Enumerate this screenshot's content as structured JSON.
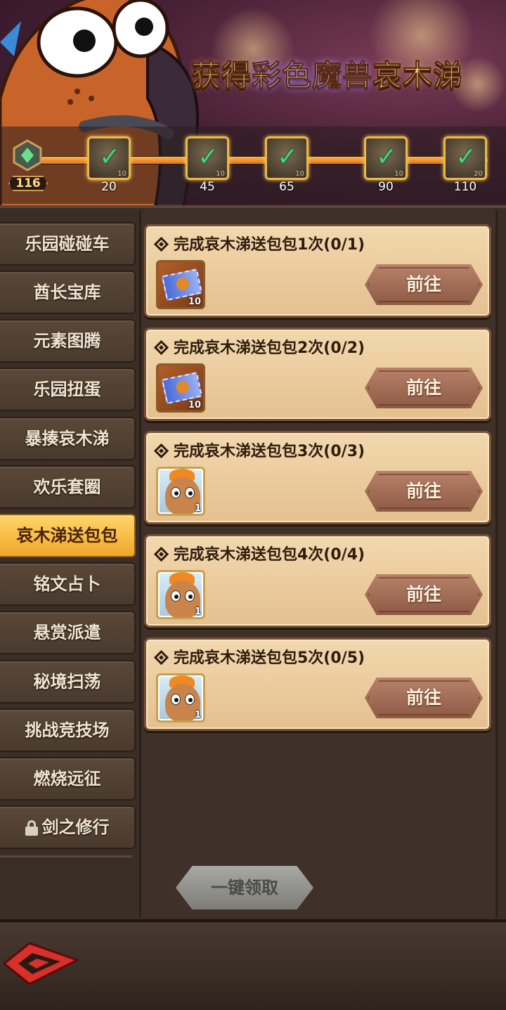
{
  "banner": {
    "title_part1": "获得",
    "title_part2": "彩色魔兽",
    "title_part3": "哀木涕"
  },
  "progress": {
    "current_level": "116",
    "fill_fraction": 1.0,
    "milestones": [
      {
        "label": "20",
        "count": "10",
        "claimed": true
      },
      {
        "label": "45",
        "count": "10",
        "claimed": true
      },
      {
        "label": "65",
        "count": "10",
        "claimed": true
      },
      {
        "label": "90",
        "count": "10",
        "claimed": true
      },
      {
        "label": "110",
        "count": "20",
        "claimed": true
      }
    ]
  },
  "sidebar": {
    "items": [
      {
        "label": "乐园碰碰车"
      },
      {
        "label": "酋长宝库"
      },
      {
        "label": "元素图腾"
      },
      {
        "label": "乐园扭蛋"
      },
      {
        "label": "暴揍哀木涕"
      },
      {
        "label": "欢乐套圈"
      },
      {
        "label": "哀木涕送包包",
        "active": true
      },
      {
        "label": "铭文占卜"
      },
      {
        "label": "悬赏派遣"
      },
      {
        "label": "秘境扫荡"
      },
      {
        "label": "挑战竞技场"
      },
      {
        "label": "燃烧远征"
      },
      {
        "label": "剑之修行",
        "locked": true
      }
    ]
  },
  "tasks": [
    {
      "title": "完成哀木涕送包包1次(0/1)",
      "reward_type": "ticket",
      "reward_qty": "10",
      "button": "前往"
    },
    {
      "title": "完成哀木涕送包包2次(0/2)",
      "reward_type": "ticket",
      "reward_qty": "10",
      "button": "前往"
    },
    {
      "title": "完成哀木涕送包包3次(0/3)",
      "reward_type": "hero",
      "reward_qty": "1",
      "button": "前往"
    },
    {
      "title": "完成哀木涕送包包4次(0/4)",
      "reward_type": "hero",
      "reward_qty": "1",
      "button": "前往"
    },
    {
      "title": "完成哀木涕送包包5次(0/5)",
      "reward_type": "hero",
      "reward_qty": "1",
      "button": "前往"
    }
  ],
  "claim_all_label": "一键领取",
  "icons": {
    "back": "back-arrow-icon",
    "lock": "lock-icon",
    "check": "check-icon",
    "diamond": "diamond-bullet-icon"
  },
  "colors": {
    "active_tab": "#f0a72a",
    "card_bg": "#f2d8ae",
    "go_button": "#a8705a",
    "claim_disabled": "#8e8e8a",
    "check_green": "#3fd87a",
    "back_red": "#d8302a"
  }
}
